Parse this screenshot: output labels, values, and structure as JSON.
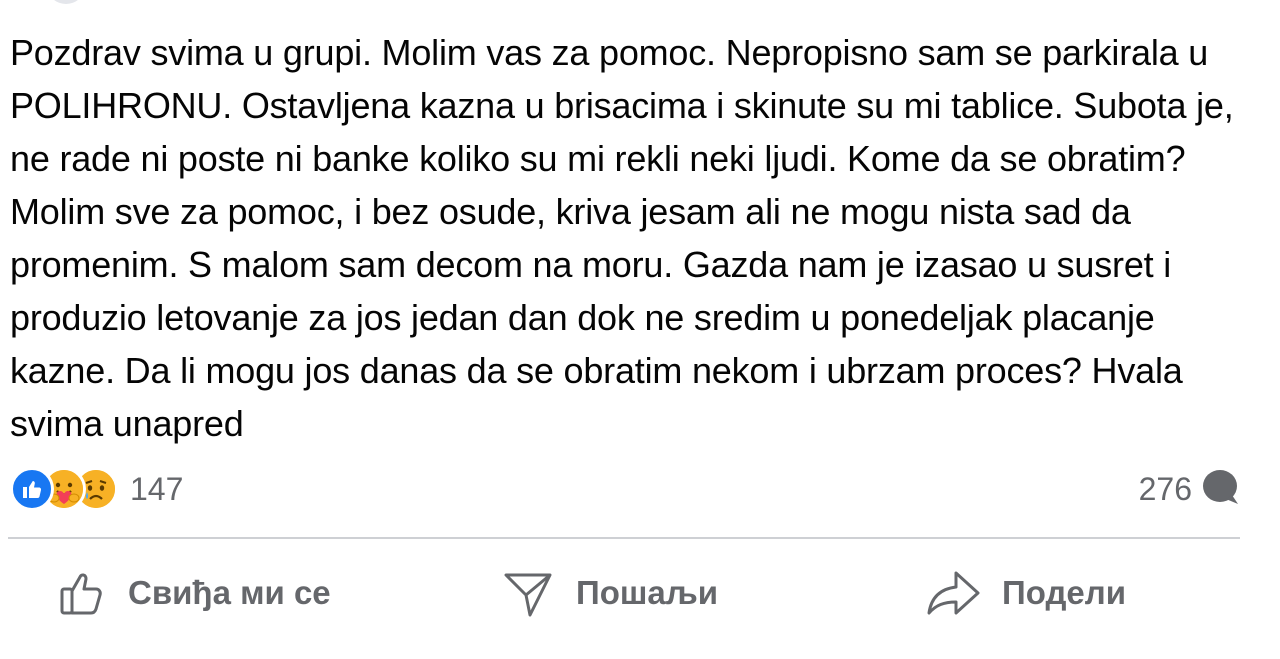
{
  "post": {
    "body": "Pozdrav svima u grupi. Molim vas za pomoc. Nepropisno sam se parkirala u POLIHRONU. Ostavljena kazna u brisacima i skinute su mi tablice. Subota je, ne rade ni poste ni banke koliko su mi rekli neki ljudi. Kome da se obratim? Molim sve za pomoc, i bez osude, kriva jesam ali ne mogu nista sad da promenim. S malom sam decom na moru. Gazda nam je izasao u susret i produzio letovanje za jos jedan dan dok ne sredim u ponedeljak placanje kazne. Da li mogu jos danas da se obratim nekom i ubrzam proces? Hvala svima unapred"
  },
  "stats": {
    "reaction_icons": [
      "like-icon",
      "care-icon",
      "sad-icon"
    ],
    "reaction_count": "147",
    "comment_count": "276",
    "comment_icon": "comment-bubble-icon"
  },
  "actions": {
    "like_label": "Свиђа ми се",
    "send_label": "Пошаљи",
    "share_label": "Подели"
  },
  "colors": {
    "like_blue": "#1877f2",
    "emoji_yellow": "#f7b125",
    "secondary_text": "#65676b",
    "primary_text": "#050505",
    "divider": "#ced0d4"
  }
}
